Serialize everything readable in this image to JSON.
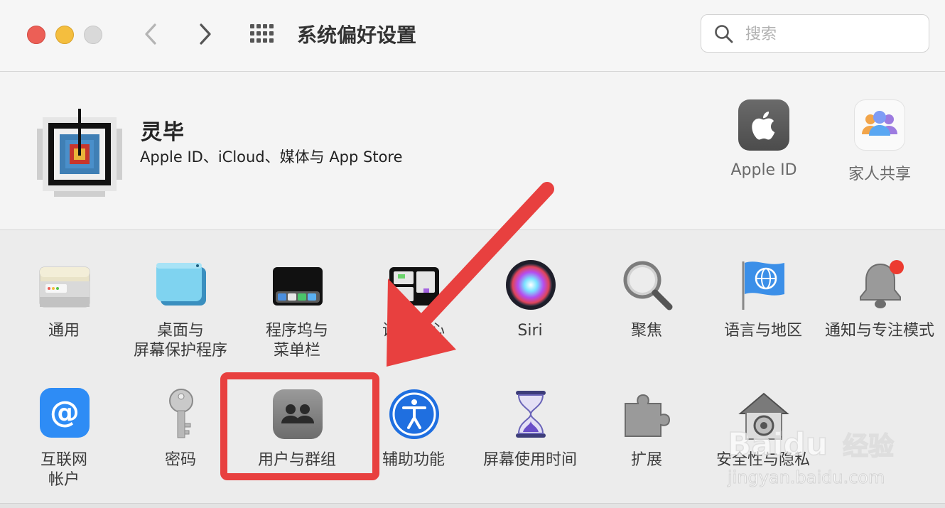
{
  "window": {
    "title": "系统偏好设置",
    "traffic_lights": {
      "close": "#ec5f56",
      "minimize": "#f4be3e",
      "zoom": "#d9d9d9"
    }
  },
  "search": {
    "placeholder": "搜索"
  },
  "account": {
    "name": "灵毕",
    "subtitle": "Apple ID、iCloud、媒体与 App Store",
    "top_items": [
      {
        "label": "Apple ID",
        "icon": "apple-logo-icon"
      },
      {
        "label": "家人共享",
        "icon": "family-sharing-icon"
      }
    ]
  },
  "prefs_row1": [
    {
      "lines": [
        "通用"
      ],
      "icon": "general-icon"
    },
    {
      "lines": [
        "桌面与",
        "屏幕保护程序"
      ],
      "icon": "desktop-screensaver-icon"
    },
    {
      "lines": [
        "程序坞与",
        "菜单栏"
      ],
      "icon": "dock-menubar-icon"
    },
    {
      "lines": [
        "调度中心"
      ],
      "icon": "mission-control-icon"
    },
    {
      "lines": [
        "Siri"
      ],
      "icon": "siri-icon"
    },
    {
      "lines": [
        "聚焦"
      ],
      "icon": "spotlight-icon"
    },
    {
      "lines": [
        "语言与地区"
      ],
      "icon": "language-region-icon"
    },
    {
      "lines": [
        "通知与专注模式"
      ],
      "icon": "notifications-icon"
    }
  ],
  "prefs_row2": [
    {
      "lines": [
        "互联网",
        "帐户"
      ],
      "icon": "internet-accounts-icon"
    },
    {
      "lines": [
        "密码"
      ],
      "icon": "passwords-icon"
    },
    {
      "lines": [
        "用户与群组"
      ],
      "icon": "users-groups-icon"
    },
    {
      "lines": [
        "辅助功能"
      ],
      "icon": "accessibility-icon"
    },
    {
      "lines": [
        "屏幕使用时间"
      ],
      "icon": "screen-time-icon"
    },
    {
      "lines": [
        "扩展"
      ],
      "icon": "extensions-icon"
    },
    {
      "lines": [
        "安全性与隐私"
      ],
      "icon": "security-privacy-icon"
    }
  ],
  "annotation": {
    "color": "#e8403f",
    "highlighted_item": "用户与群组"
  },
  "watermark": {
    "brand": "Baidu",
    "brand_cn": "经验",
    "url": "jingyan.baidu.com"
  }
}
